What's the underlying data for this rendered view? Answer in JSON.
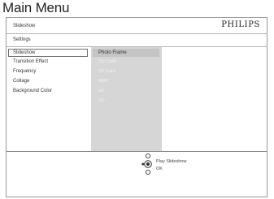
{
  "heading": "Main Menu",
  "header": {
    "title": "Slideshow",
    "brand": "PHILIPS",
    "subtitle": "Settings"
  },
  "menu": {
    "items": [
      {
        "label": "Slideshow"
      },
      {
        "label": "Transition Effect"
      },
      {
        "label": "Frequency"
      },
      {
        "label": "Collage"
      },
      {
        "label": "Background Color"
      }
    ]
  },
  "options": {
    "items": [
      {
        "label": "Photo Frame"
      },
      {
        "label": "SD Card"
      },
      {
        "label": "CF Card"
      },
      {
        "label": "MMC"
      },
      {
        "label": "xD"
      },
      {
        "label": "SD"
      }
    ]
  },
  "footer": {
    "play_label": "Play Slideshow",
    "ok_label": "OK"
  },
  "colors": {
    "panel_gray": "#d6d6d6",
    "highlight_gray": "#c4c4c4",
    "text": "#333333"
  }
}
